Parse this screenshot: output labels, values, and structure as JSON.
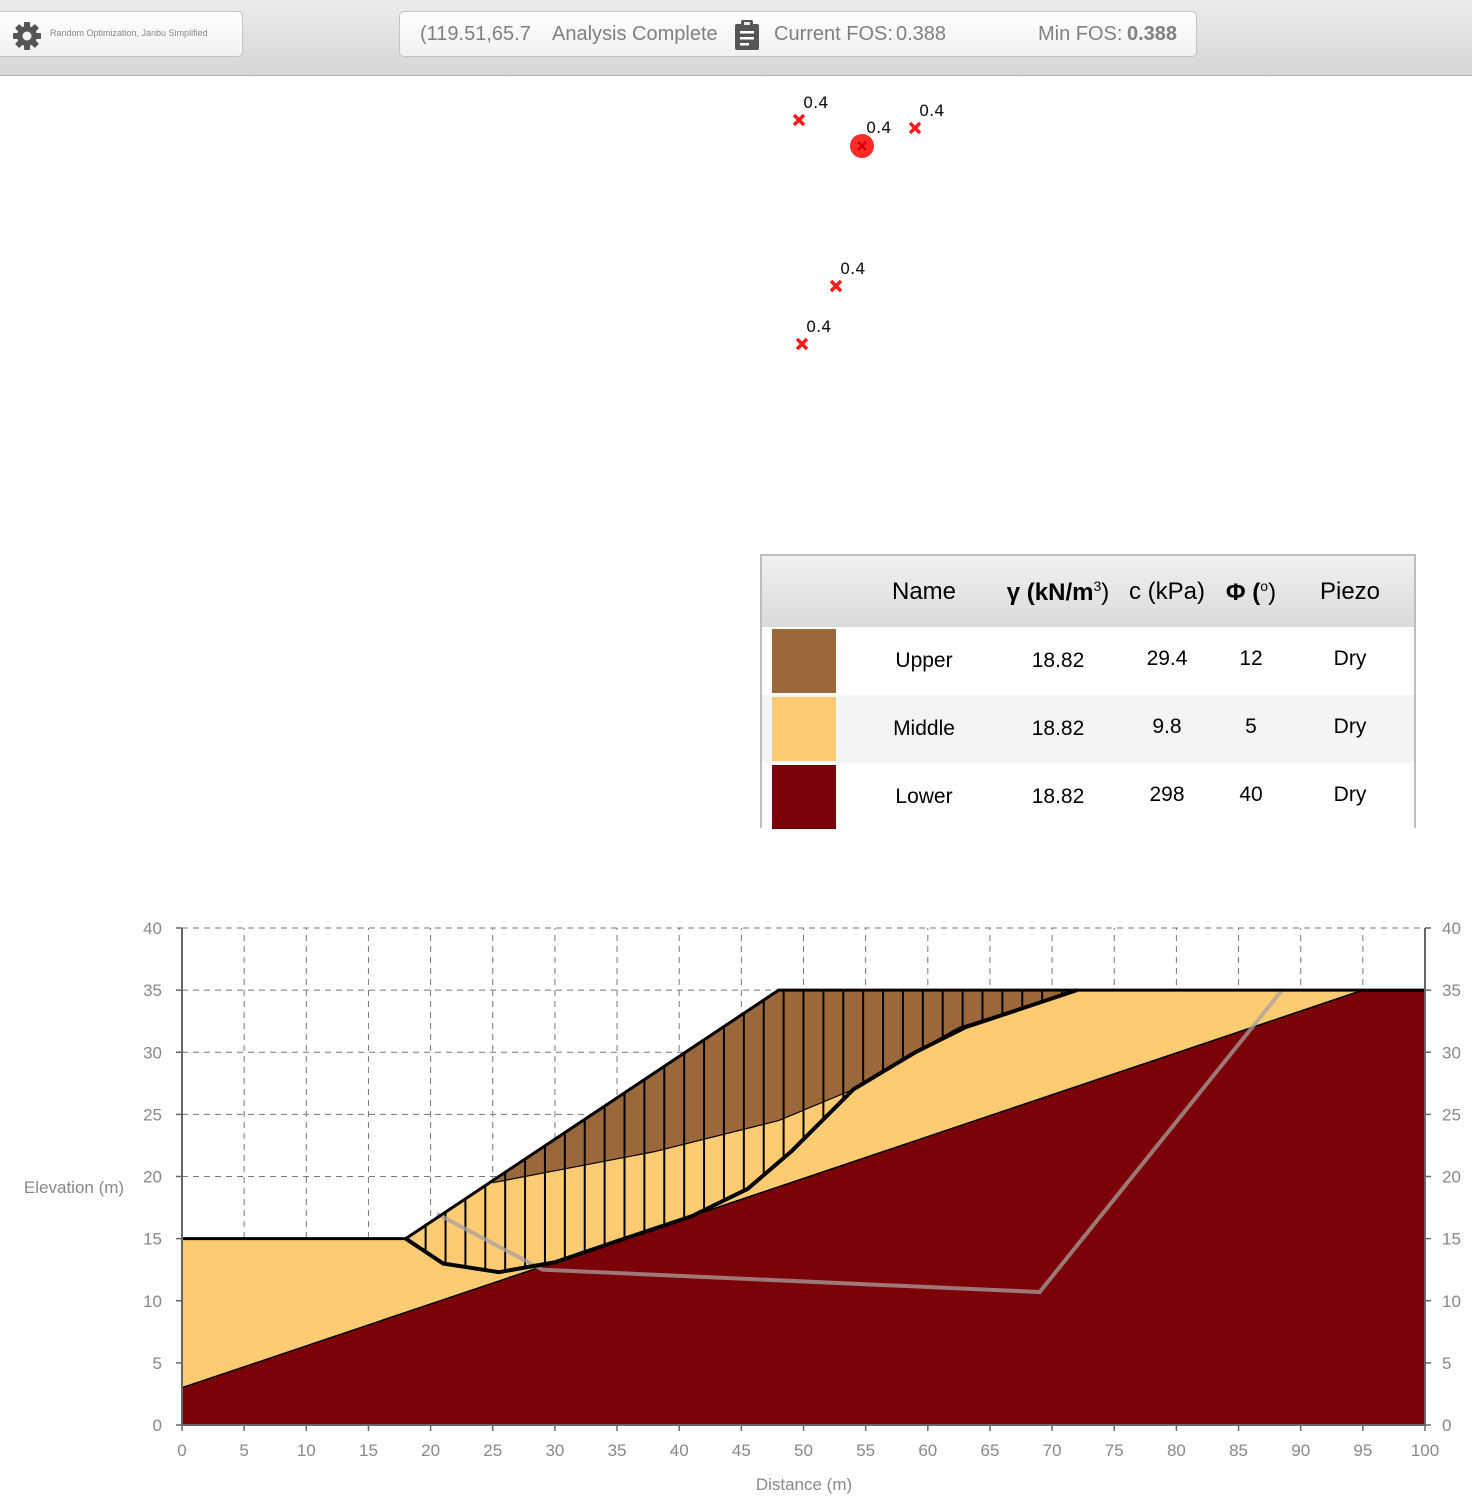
{
  "toolbar": {
    "settings_label": "Random Optimization, Janbu Simplified",
    "coords": "(119.51,65.7",
    "status": "Analysis Complete",
    "current_fos_label": "Current FOS:",
    "current_fos_value": "0.388",
    "min_fos_label": "Min FOS:",
    "min_fos_value": "0.388"
  },
  "search_points": [
    {
      "label": "0.4",
      "selected": false
    },
    {
      "label": "0.4",
      "selected": true
    },
    {
      "label": "0.4",
      "selected": false
    },
    {
      "label": "0.4",
      "selected": false
    },
    {
      "label": "0.4",
      "selected": false
    }
  ],
  "materials": {
    "headers": {
      "name": "Name",
      "gamma_prefix": "γ (kN/m",
      "gamma_sup": "3",
      "gamma_suffix": ")",
      "c": "c (kPa)",
      "phi_prefix": "Φ (",
      "phi_sup": "o",
      "phi_suffix": ")",
      "piezo": "Piezo"
    },
    "rows": [
      {
        "color": "#9a683b",
        "name": "Upper",
        "gamma": "18.82",
        "c": "29.4",
        "phi": "12",
        "piezo": "Dry"
      },
      {
        "color": "#fdcc72",
        "name": "Middle",
        "gamma": "18.82",
        "c": "9.8",
        "phi": "5",
        "piezo": "Dry"
      },
      {
        "color": "#7b0207",
        "name": "Lower",
        "gamma": "18.82",
        "c": "298",
        "phi": "40",
        "piezo": "Dry"
      }
    ]
  },
  "chart_data": {
    "type": "area",
    "xlabel": "Distance (m)",
    "ylabel": "Elevation (m)",
    "xlim": [
      0,
      100
    ],
    "ylim": [
      0,
      40
    ],
    "x_ticks": [
      0,
      5,
      10,
      15,
      20,
      25,
      30,
      35,
      40,
      45,
      50,
      55,
      60,
      65,
      70,
      75,
      80,
      85,
      90,
      95,
      100
    ],
    "y_ticks": [
      0,
      5,
      10,
      15,
      20,
      25,
      30,
      35,
      40
    ],
    "grid": true,
    "layers": [
      {
        "name": "Lower",
        "color": "#7b0207",
        "points": [
          [
            0,
            3
          ],
          [
            0,
            0
          ],
          [
            100,
            0
          ],
          [
            100,
            35
          ],
          [
            95,
            35
          ]
        ]
      },
      {
        "name": "Middle",
        "color": "#fdcc72",
        "points": [
          [
            0,
            15
          ],
          [
            18,
            15
          ],
          [
            48,
            35
          ],
          [
            100,
            35
          ],
          [
            95,
            35
          ],
          [
            0,
            3
          ]
        ]
      },
      {
        "name": "Upper",
        "color": "#9a683b",
        "points": [
          [
            25,
            19.5
          ],
          [
            48,
            35
          ],
          [
            72,
            35
          ],
          [
            62.5,
            32
          ],
          [
            59,
            30
          ],
          [
            54,
            27
          ],
          [
            48,
            24.5
          ],
          [
            38,
            22
          ],
          [
            25,
            19.5
          ]
        ]
      }
    ],
    "ground_surface": [
      [
        0,
        15
      ],
      [
        18,
        15
      ],
      [
        48,
        35
      ],
      [
        100,
        35
      ]
    ],
    "slip_surface": [
      [
        18,
        15
      ],
      [
        21,
        13
      ],
      [
        25.5,
        12.3
      ],
      [
        30,
        13.1
      ],
      [
        35,
        14.8
      ],
      [
        41,
        16.8
      ],
      [
        45.5,
        19
      ],
      [
        49,
        22
      ],
      [
        54,
        27
      ],
      [
        59,
        30
      ],
      [
        63,
        32
      ],
      [
        72,
        35
      ]
    ],
    "slice_x": [
      19.6,
      21.2,
      22.8,
      24.4,
      26,
      27.6,
      29.2,
      30.8,
      32.4,
      34,
      35.6,
      37.2,
      38.8,
      40.4,
      42,
      43.6,
      45.2,
      46.8,
      48.4,
      50,
      51.6,
      53.2,
      54.8,
      56.4,
      58,
      59.6,
      61.2,
      62.8,
      64.4,
      66,
      67.6,
      69.2,
      70.8
    ],
    "piezo_line": [
      [
        20.5,
        17
      ],
      [
        29,
        12.5
      ],
      [
        69,
        10.7
      ],
      [
        88.5,
        35
      ]
    ]
  }
}
